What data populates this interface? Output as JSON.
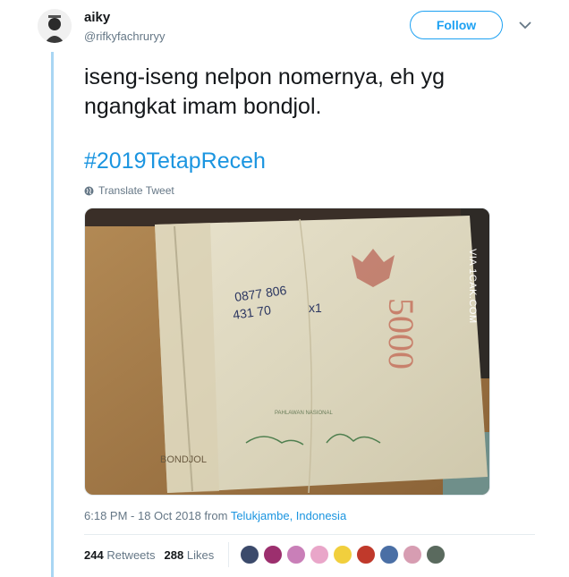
{
  "user": {
    "name": "aiky",
    "handle": "@rifkyfachruryy"
  },
  "follow_label": "Follow",
  "tweet": {
    "line1": "iseng-iseng nelpon nomernya, eh yg",
    "line2": "ngangkat imam bondjol.",
    "hashtag": "#2019TetapReceh",
    "translate_label": "Translate Tweet"
  },
  "photo": {
    "watermark": "VIA 1CAK.COM",
    "banknote_value": "5000",
    "handwriting_line1": "0877 806",
    "handwriting_line2": "431 70",
    "handwriting_mark": "x1",
    "note_name": "BONDJOL",
    "note_caption": "PAHLAWAN NASIONAL"
  },
  "meta": {
    "time": "6:18 PM - 18 Oct 2018",
    "from_label": "from",
    "location": "Telukjambe, Indonesia"
  },
  "stats": {
    "retweets_count": "244",
    "retweets_label": "Retweets",
    "likes_count": "288",
    "likes_label": "Likes"
  },
  "likers_colors": [
    "#3b4a6b",
    "#9c2f6e",
    "#c97fb8",
    "#e9a6c9",
    "#f1cf3d",
    "#c0392b",
    "#4a6fa5",
    "#d79db2",
    "#5a6a5e"
  ],
  "colors": {
    "accent": "#1da1f2",
    "link": "#1b95e0",
    "thread": "#a9d6f3",
    "muted": "#657786"
  }
}
